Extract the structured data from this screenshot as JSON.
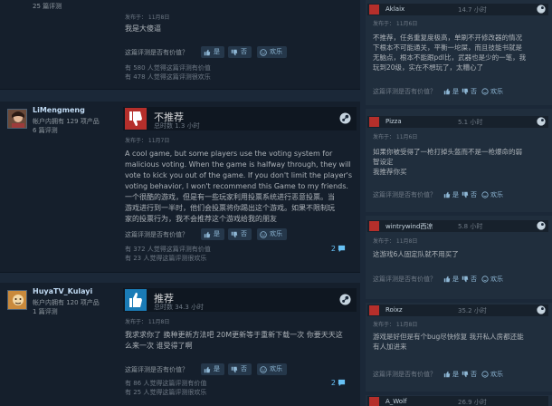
{
  "labels": {
    "helpful_question": "这篇评测是否有价值？",
    "yes": "是",
    "no": "否",
    "funny": "欢乐",
    "steam_posted_prefix": "发布于："
  },
  "colors": {
    "background": "#1b2838",
    "recommended": "#1a7bb6",
    "not_recommended": "#b52f2b",
    "link": "#67c1f5"
  },
  "reviews": [
    {
      "persona": "",
      "owned": "",
      "review_count": "25 篇评测",
      "vote": "",
      "hours": "",
      "posted": "发布于： 11月8日",
      "lines": [
        "我是大傻逼"
      ],
      "helpful_count": "有 580 人觉得这篇评测有价值",
      "funny_count": "有 478 人觉得这篇评测很欢乐",
      "comments": ""
    },
    {
      "persona": "LiMengmeng",
      "owned": "帐户内拥有 129 项产品",
      "review_count": "6 篇评测",
      "vote": "不推荐",
      "hours": "总时数 1.3 小时",
      "posted": "发布于： 11月7日",
      "lines": [
        "A cool game, but some players use the voting system for",
        "malicious voting. When the game is halfway through, they will",
        "vote to kick you out of the game. If you don't limit the player's",
        "voting behavior, I won't recommend this Game to my friends.",
        "一个很酷的游戏，但是有一些玩家利用投票系统进行恶意投票。当",
        "游戏进行到一半时，他们会投票将你踢出这个游戏。如果不限制玩",
        "家的投票行为，我不会推荐这个游戏给我的朋友"
      ],
      "helpful_count": "有 372 人觉得这篇评测有价值",
      "funny_count": "有 23 人觉得这篇评测很欢乐",
      "comments": "2"
    },
    {
      "persona": "HuyaTV_Kulayi",
      "owned": "帐户内拥有 120 项产品",
      "review_count": "1 篇评测",
      "vote": "推荐",
      "hours": "总时数 34.3 小时",
      "posted": "发布于： 11月8日",
      "lines": [
        "我求求你了 换种更新方法吧 20M更新等于重新下载一次 你要天天这",
        "么来一次 谁受得了啊"
      ],
      "helpful_count": "有 86 人觉得这篇评测有价值",
      "funny_count": "有 25 人觉得这篇评测很欢乐",
      "comments": "2"
    }
  ],
  "side_reviews": [
    {
      "name": "Aklaix",
      "hours": "14.7 小时",
      "posted": "发布于： 11月6日",
      "lines": [
        "不推荐，任务重复度极高，单刷不开修改器的情况",
        "下根本不可能通关，平衡一坨屎，而且技能书就是",
        "无脑点，根本不能跟pdl比，武器也是少的一笔，我",
        "玩到20级，实在不想玩了，太糟心了"
      ]
    },
    {
      "name": "Pizza",
      "hours": "5.1 小时",
      "posted": "发布于： 11月6日",
      "lines": [
        "如果你被受得了一枪打掉头盔而不是一枪爆命的弱",
        "智设定",
        "我推荐你买"
      ]
    },
    {
      "name": "wintrywind西凉",
      "hours": "5.8 小时",
      "posted": "发布于： 11月8日",
      "lines": [
        "这游戏6人固定队就不用买了"
      ]
    },
    {
      "name": "Roixz",
      "hours": "35.2 小时",
      "posted": "发布于： 11月8日",
      "lines": [
        "游戏是好但是有个bug尽快修复 我开私人房都还能",
        "有人加进来"
      ]
    },
    {
      "name": "A_Wolf",
      "hours": "26.9 小时",
      "posted": "",
      "lines": []
    }
  ]
}
